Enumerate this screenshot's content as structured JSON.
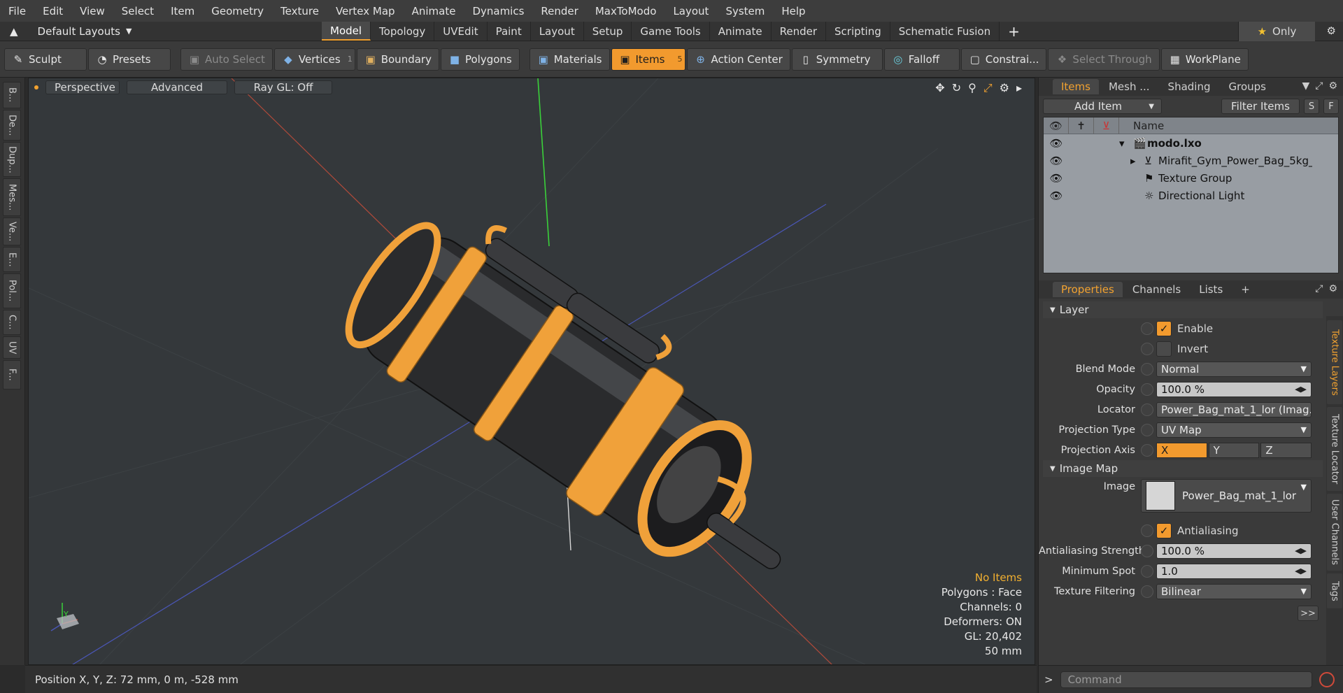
{
  "menu": [
    "File",
    "Edit",
    "View",
    "Select",
    "Item",
    "Geometry",
    "Texture",
    "Vertex Map",
    "Animate",
    "Dynamics",
    "Render",
    "MaxToModo",
    "Layout",
    "System",
    "Help"
  ],
  "layouts": {
    "label": "Default Layouts"
  },
  "tabs": [
    {
      "label": "Model",
      "active": true
    },
    {
      "label": "Topology"
    },
    {
      "label": "UVEdit"
    },
    {
      "label": "Paint"
    },
    {
      "label": "Layout"
    },
    {
      "label": "Setup"
    },
    {
      "label": "Game Tools"
    },
    {
      "label": "Animate"
    },
    {
      "label": "Render"
    },
    {
      "label": "Scripting"
    },
    {
      "label": "Schematic Fusion"
    }
  ],
  "only_label": "Only",
  "toolbar": {
    "sculpt": "Sculpt",
    "presets": "Presets",
    "auto_select": "Auto Select",
    "vertices": "Vertices",
    "vertices_count": "1",
    "boundary": "Boundary",
    "polygons": "Polygons",
    "materials": "Materials",
    "items": "Items",
    "items_count": "5",
    "action_center": "Action Center",
    "symmetry": "Symmetry",
    "falloff": "Falloff",
    "constraints": "Constrai...",
    "select_through": "Select Through",
    "workplane": "WorkPlane"
  },
  "left_tabs": [
    "B...",
    "De...",
    "Dup...",
    "Mes...",
    "Ve...",
    "E...",
    "Pol...",
    "C...",
    "UV",
    "F..."
  ],
  "viewport": {
    "perspective": "Perspective",
    "advanced": "Advanced",
    "raygl": "Ray GL: Off",
    "info": {
      "no_items": "No Items",
      "polygons": "Polygons : Face",
      "channels": "Channels: 0",
      "deformers": "Deformers: ON",
      "gl": "GL: 20,402",
      "scale": "50 mm"
    },
    "axis_y": "Y"
  },
  "status": {
    "position": "Position X, Y, Z:  72 mm, 0 m, -528 mm"
  },
  "items_panel": {
    "tabs": [
      "Items",
      "Mesh ...",
      "Shading",
      "Groups"
    ],
    "add_item": "Add Item",
    "filter_items": "Filter Items",
    "s": "S",
    "f": "F",
    "col_name": "Name",
    "rows": [
      {
        "name": "modo.lxo",
        "bold": true
      },
      {
        "name": "Mirafit_Gym_Power_Bag_5kg_..."
      },
      {
        "name": "Texture Group"
      },
      {
        "name": "Directional Light"
      }
    ]
  },
  "props_panel": {
    "tabs": [
      "Properties",
      "Channels",
      "Lists"
    ],
    "layer_section": "Layer",
    "enable": "Enable",
    "invert": "Invert",
    "blend_mode_label": "Blend Mode",
    "blend_mode": "Normal",
    "opacity_label": "Opacity",
    "opacity": "100.0 %",
    "locator_label": "Locator",
    "locator": "Power_Bag_mat_1_lor (Imag...",
    "projection_type_label": "Projection Type",
    "projection_type": "UV Map",
    "projection_axis_label": "Projection Axis",
    "axis_x": "X",
    "axis_y": "Y",
    "axis_z": "Z",
    "image_map_section": "Image Map",
    "image_label": "Image",
    "image": "Power_Bag_mat_1_lor",
    "antialiasing": "Antialiasing",
    "aa_strength_label": "Antialiasing Strength",
    "aa_strength": "100.0 %",
    "min_spot_label": "Minimum Spot",
    "min_spot": "1.0",
    "tex_filter_label": "Texture Filtering",
    "tex_filter": "Bilinear",
    "more": ">>"
  },
  "right_tabs": [
    "Texture Layers",
    "Texture Locator",
    "User Channels",
    "Tags"
  ],
  "command": {
    "placeholder": "Command"
  },
  "colors": {
    "accent": "#f29a2e",
    "bag": "#f0a13a"
  }
}
